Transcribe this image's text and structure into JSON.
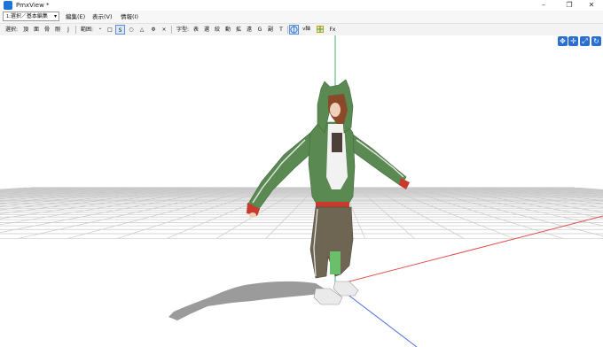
{
  "window": {
    "title": "PmxView *",
    "minimize": "–",
    "maximize": "❐",
    "close": "✕"
  },
  "menubar": {
    "mode_select": "選択／基本編集",
    "items": [
      "編集(E)",
      "表示(V)",
      "情報(I)"
    ]
  },
  "toolbar": {
    "select_label": "選択:",
    "select_items": [
      "頂",
      "面",
      "骨",
      "剛",
      "J"
    ],
    "range_label": "範囲:",
    "range_items": [
      "・",
      "□",
      "S",
      "○",
      "△",
      "Φ",
      "×"
    ],
    "font_label": "字型:",
    "font_items": [
      "表",
      "選",
      "絞",
      "動",
      "拡",
      "遠",
      "G",
      "副",
      "T"
    ],
    "axis_label": "軸",
    "grid_icon": "grid-icon",
    "fx_label": "Fx"
  },
  "view_controls": [
    "move-view-icon",
    "rotate-view-icon",
    "zoom-view-icon",
    "reset-view-icon"
  ],
  "colors": {
    "accent": "#2b6fd1",
    "grid": "#c7c7c7",
    "x_axis": "#e05050",
    "y_axis": "#3cb371",
    "z_axis": "#4a6fe0",
    "hoodie": "#5a8a52",
    "pants": "#6e6553",
    "cuffs": "#c8392e"
  }
}
